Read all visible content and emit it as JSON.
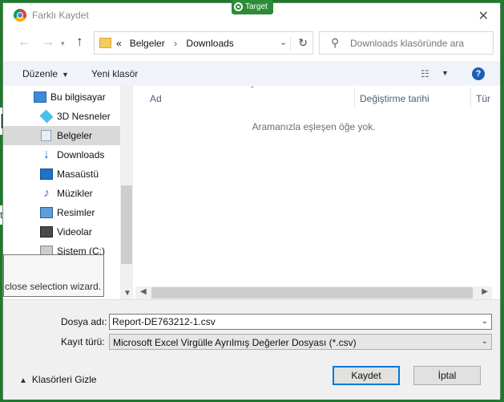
{
  "window": {
    "title": "Farklı Kaydet",
    "close": "✕"
  },
  "badge": {
    "label": "Target"
  },
  "address": {
    "chevrons": "«",
    "crumbs": [
      "Belgeler",
      "Downloads"
    ],
    "separator": "›"
  },
  "search": {
    "placeholder": "Downloads klasöründe ara"
  },
  "toolbar": {
    "organize": "Düzenle",
    "new_folder": "Yeni klasör",
    "help": "?"
  },
  "nav": {
    "items": [
      {
        "label": "Bu bilgisayar",
        "icon": "computer-icon"
      },
      {
        "label": "3D Nesneler",
        "icon": "cube-icon"
      },
      {
        "label": "Belgeler",
        "icon": "document-icon",
        "selected": true
      },
      {
        "label": "Downloads",
        "icon": "download-arrow-icon"
      },
      {
        "label": "Masaüstü",
        "icon": "desktop-icon"
      },
      {
        "label": "Müzikler",
        "icon": "music-note-icon"
      },
      {
        "label": "Resimler",
        "icon": "pictures-icon"
      },
      {
        "label": "Videolar",
        "icon": "film-icon"
      },
      {
        "label": "Sistem (C:)",
        "icon": "drive-icon"
      }
    ]
  },
  "tooltip": {
    "text": "close selection wizard."
  },
  "files": {
    "columns": [
      "Ad",
      "Değiştirme tarihi",
      "Tür"
    ],
    "empty_message": "Aramanızla eşleşen öğe yok."
  },
  "form": {
    "filename_label": "Dosya adı:",
    "filename_value": "Report-DE763212-1.csv",
    "type_label": "Kayıt türü:",
    "type_value": "Microsoft Excel Virgülle Ayrılmış Değerler Dosyası (*.csv)",
    "hide_folders": "Klasörleri Gizle",
    "save": "Kaydet",
    "cancel": "İptal"
  },
  "background": {
    "letter": "N",
    "snippet": "to"
  }
}
